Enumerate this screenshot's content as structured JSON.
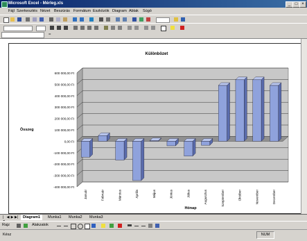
{
  "window": {
    "title": "Microsoft Excel - Mérleg.xls",
    "minimize_glyph": "_",
    "maximize_glyph": "□",
    "close_glyph": "×"
  },
  "menu": {
    "items": [
      "Fájl",
      "Szerkesztés",
      "Nézet",
      "Beszúrás",
      "Formátum",
      "Eszközök",
      "Diagram",
      "Ablak",
      "Súgó"
    ]
  },
  "formula_bar": {
    "fx_label": "="
  },
  "sheet_tabs": {
    "nav": [
      "|◀",
      "◀",
      "▶",
      "▶|"
    ],
    "tabs": [
      "Diagram1",
      "Munka1",
      "Munka2",
      "Munka3"
    ],
    "active_index": 0
  },
  "drawing_toolbar": {
    "draw_label": "Rajz",
    "autoshapes_label": "Alakzatok"
  },
  "status_bar": {
    "status_text": "Kész",
    "num_indicator": "NUM"
  },
  "colors": {
    "titlebar": "#0a246a",
    "bar_face": "#8fa2dc",
    "bar_side": "#5a6cad",
    "bar_top": "#b9c6ee",
    "plot_wall": "#c8c8c8",
    "floor": "#909090"
  },
  "chart_data": {
    "type": "bar",
    "title": "Különbözet",
    "xlabel": "Hónap",
    "ylabel": "Összeg",
    "ylim": [
      -400000,
      600000
    ],
    "y_tick_labels": [
      "600 000,00 Ft",
      "500 000,00 Ft",
      "400 000,00 Ft",
      "300 000,00 Ft",
      "200 000,00 Ft",
      "100 000,00 Ft",
      "0,00 Ft",
      "-100 000,00 Ft",
      "-200 000,00 Ft",
      "-300 000,00 Ft",
      "-400 000,00 Ft"
    ],
    "y_ticks": [
      600000,
      500000,
      400000,
      300000,
      200000,
      100000,
      0,
      -100000,
      -200000,
      -300000,
      -400000
    ],
    "categories": [
      "Január",
      "Február",
      "Március",
      "Április",
      "Május",
      "Június",
      "Július",
      "Augusztus",
      "Szeptember",
      "Október",
      "November",
      "December"
    ],
    "values": [
      -140000,
      50000,
      -165000,
      -345000,
      5000,
      -40000,
      -130000,
      -35000,
      490000,
      540000,
      540000,
      490000
    ],
    "grid": true,
    "legend": "none"
  }
}
